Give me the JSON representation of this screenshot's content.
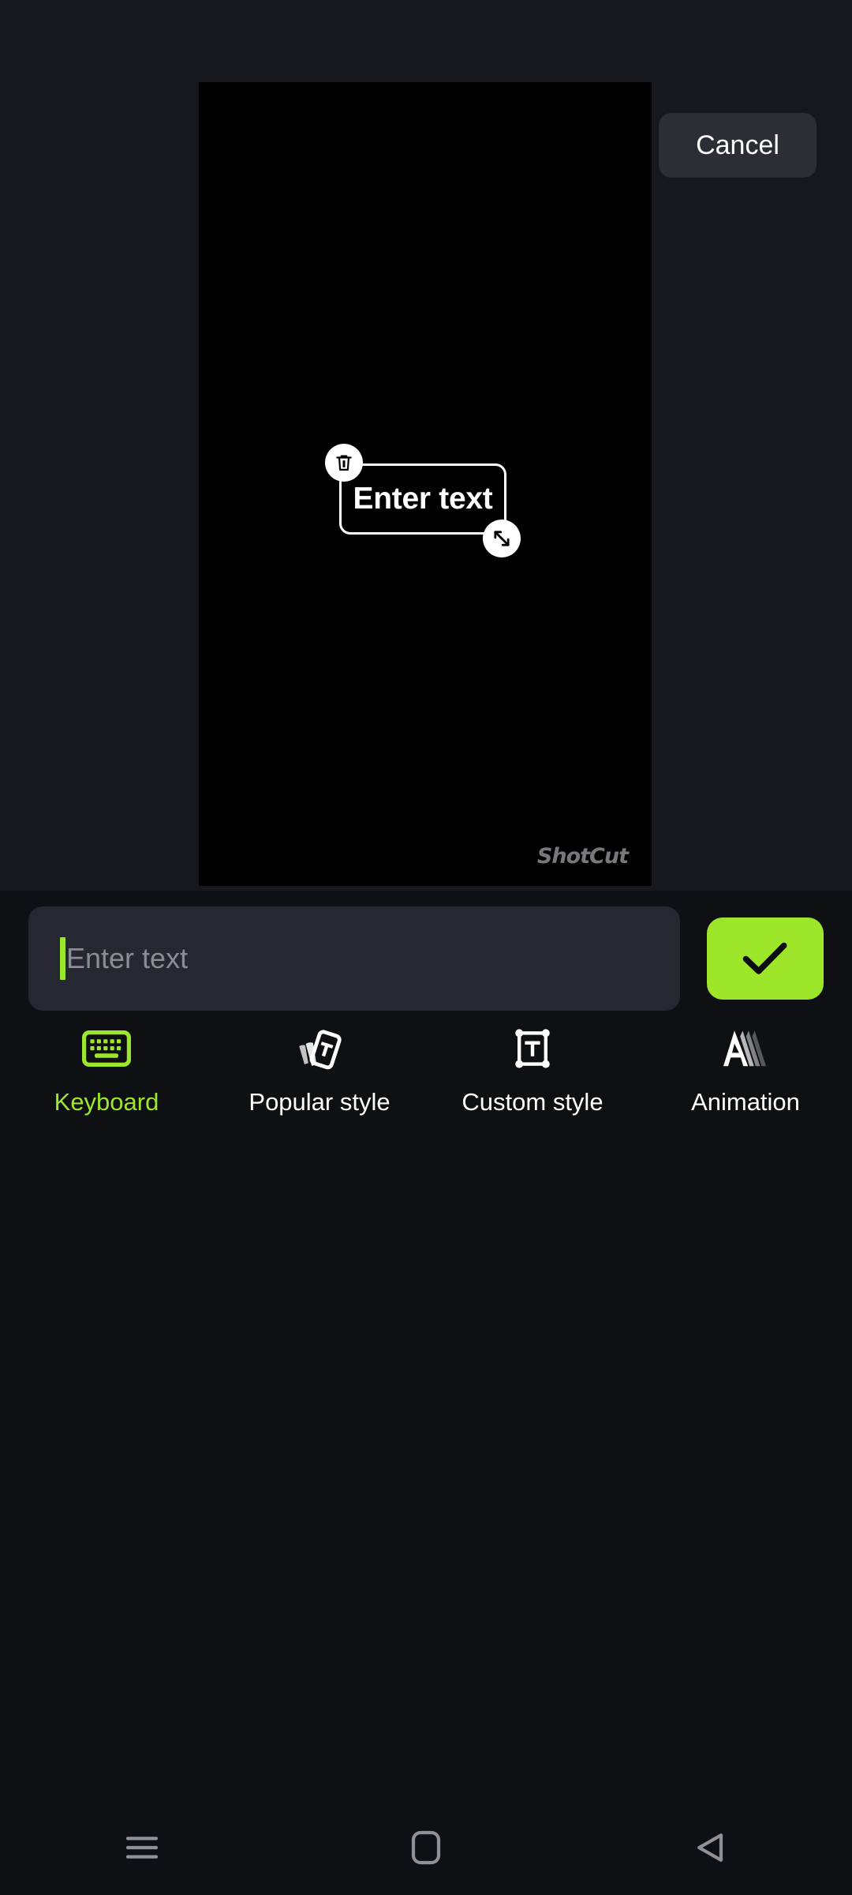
{
  "app": {
    "name": "ShotCut",
    "watermark": "ShotCut"
  },
  "preview": {
    "overlay": {
      "text": "Enter text",
      "delete_handle_icon": "trash-icon",
      "resize_handle_icon": "resize-diagonal-icon"
    }
  },
  "header": {
    "cancel_label": "Cancel"
  },
  "editor": {
    "input_placeholder": "Enter text",
    "input_value": "",
    "confirm_icon": "check-icon",
    "accent_color": "#9ee62a",
    "panel_bg": "#0e1014",
    "input_bg": "#252831"
  },
  "tabs": [
    {
      "label": "Keyboard",
      "icon": "keyboard-icon",
      "active": true
    },
    {
      "label": "Popular style",
      "icon": "popular-style-icon",
      "active": false
    },
    {
      "label": "Custom style",
      "icon": "custom-style-icon",
      "active": false
    },
    {
      "label": "Animation",
      "icon": "animation-icon",
      "active": false
    }
  ],
  "navbar": [
    {
      "name": "recents",
      "icon": "hamburger-icon"
    },
    {
      "name": "home",
      "icon": "square-icon"
    },
    {
      "name": "back",
      "icon": "triangle-left-icon"
    }
  ]
}
